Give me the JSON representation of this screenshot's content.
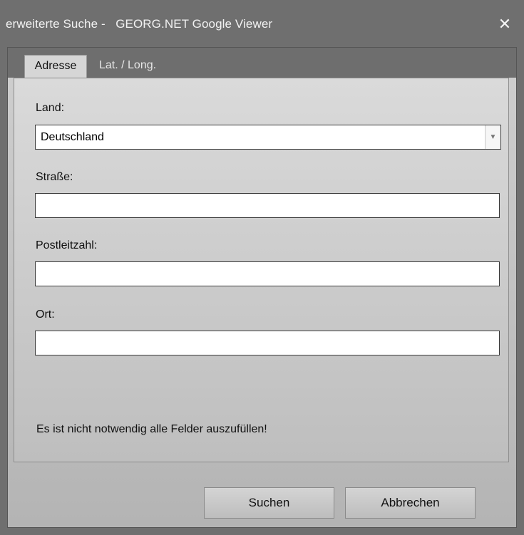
{
  "window": {
    "title": "erweiterte Suche -   GEORG.NET Google Viewer",
    "close_glyph": "✕"
  },
  "tabs": [
    {
      "label": "Adresse",
      "active": true
    },
    {
      "label": "Lat. / Long.",
      "active": false
    }
  ],
  "form": {
    "country_label": "Land:",
    "country_value": "Deutschland",
    "street_label": "Straße:",
    "street_value": "",
    "zip_label": "Postleitzahl:",
    "zip_value": "",
    "city_label": "Ort:",
    "city_value": ""
  },
  "note": "Es ist nicht notwendig alle Felder auszufüllen!",
  "buttons": {
    "search": "Suchen",
    "cancel": "Abbrechen"
  },
  "icons": {
    "close": "close-icon",
    "dropdown": "chevron-down-icon"
  }
}
